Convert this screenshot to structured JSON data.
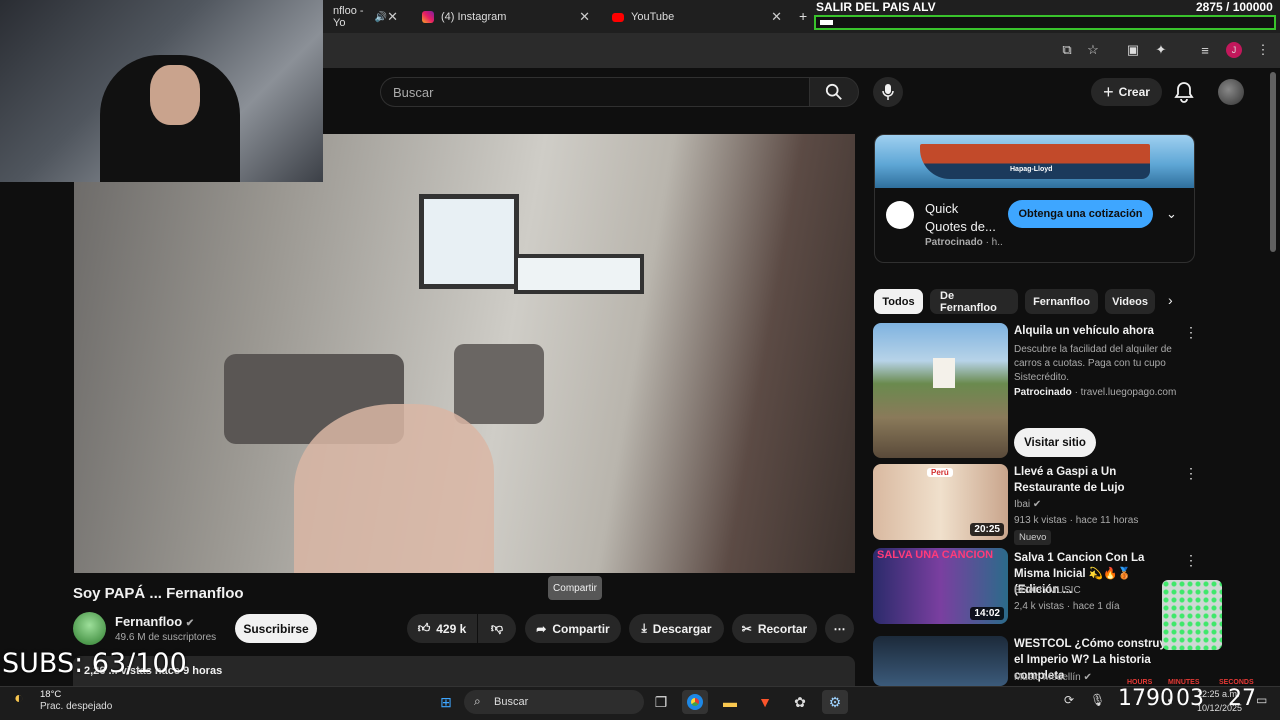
{
  "browser": {
    "tabs": [
      {
        "label": "nfloo - Yo",
        "active": false
      },
      {
        "label": "(4) Instagram",
        "active": false
      },
      {
        "label": "YouTube",
        "active": true
      }
    ]
  },
  "goal_overlay": {
    "title": "SALIR DEL PAIS ALV",
    "count": "2875 / 100000",
    "progress": 0.029
  },
  "header": {
    "search_placeholder": "Buscar",
    "create_label": "Crear"
  },
  "video": {
    "title": "Soy PAPÁ ... Fernanfloo",
    "channel": "Fernanfloo",
    "subscribers": "49.6 M de suscriptores",
    "subscribe_label": "Suscribirse",
    "likes": "429 k",
    "share_label": "Compartir",
    "download_label": "Descargar",
    "clip_label": "Recortar",
    "tooltip": "Compartir",
    "description_stub": "2,26 ... vistas  hace 9 horas"
  },
  "subs_overlay": "SUBS: 63/100",
  "ad": {
    "banner_brand": "Hapag-Lloyd",
    "title": "Quick Quotes de...",
    "sponsor": "Patrocinado",
    "sponsor_tail": "· h..",
    "cta": "Obtenga una cotización"
  },
  "chips": [
    "Todos",
    "De Fernanfloo",
    "Fernanfloo",
    "Videos"
  ],
  "recommendations": [
    {
      "title": "Alquila un vehículo ahora",
      "description": "Descubre la facilidad del alquiler de carros a cuotas. Paga con tu cupo Sistecrédito.",
      "sponsor": "Patrocinado",
      "domain": "· travel.luegopago.com",
      "cta": "Visitar sitio"
    },
    {
      "title": "Llevé a Gaspi a Un Restaurante de Lujo",
      "channel": "Ibai",
      "meta": "913 k vistas · hace 11 horas",
      "badge": "Nuevo",
      "duration": "20:25"
    },
    {
      "title": "Salva 1 Cancion Con La Misma Inicial 💫🔥🥉 (Edición ...",
      "channel": "BRAHYMUSIC",
      "meta": "2,4 k vistas · hace 1 día",
      "duration": "14:02"
    },
    {
      "title": "WESTCOL ¿Cómo construyó el Imperio W? La historia completa",
      "channel": "Music Medellín"
    }
  ],
  "thumb_texts": {
    "salva": "SALVA UNA CANCION",
    "peru": "Perú"
  },
  "taskbar": {
    "temperature": "18°C",
    "weather": "Prac. despejado",
    "search_label": "Buscar",
    "timer_hours": "1790",
    "timer_minutes": "03",
    "timer_seconds": "27",
    "timer_labels": [
      "HOURS",
      "MINUTES",
      "SECONDS"
    ],
    "clock_time": "12:25 a.m.",
    "clock_date": "10/12/2025"
  },
  "colors": {
    "accent": "#3ea6ff",
    "goal_border": "#39c32c",
    "red": "#ff0000"
  }
}
